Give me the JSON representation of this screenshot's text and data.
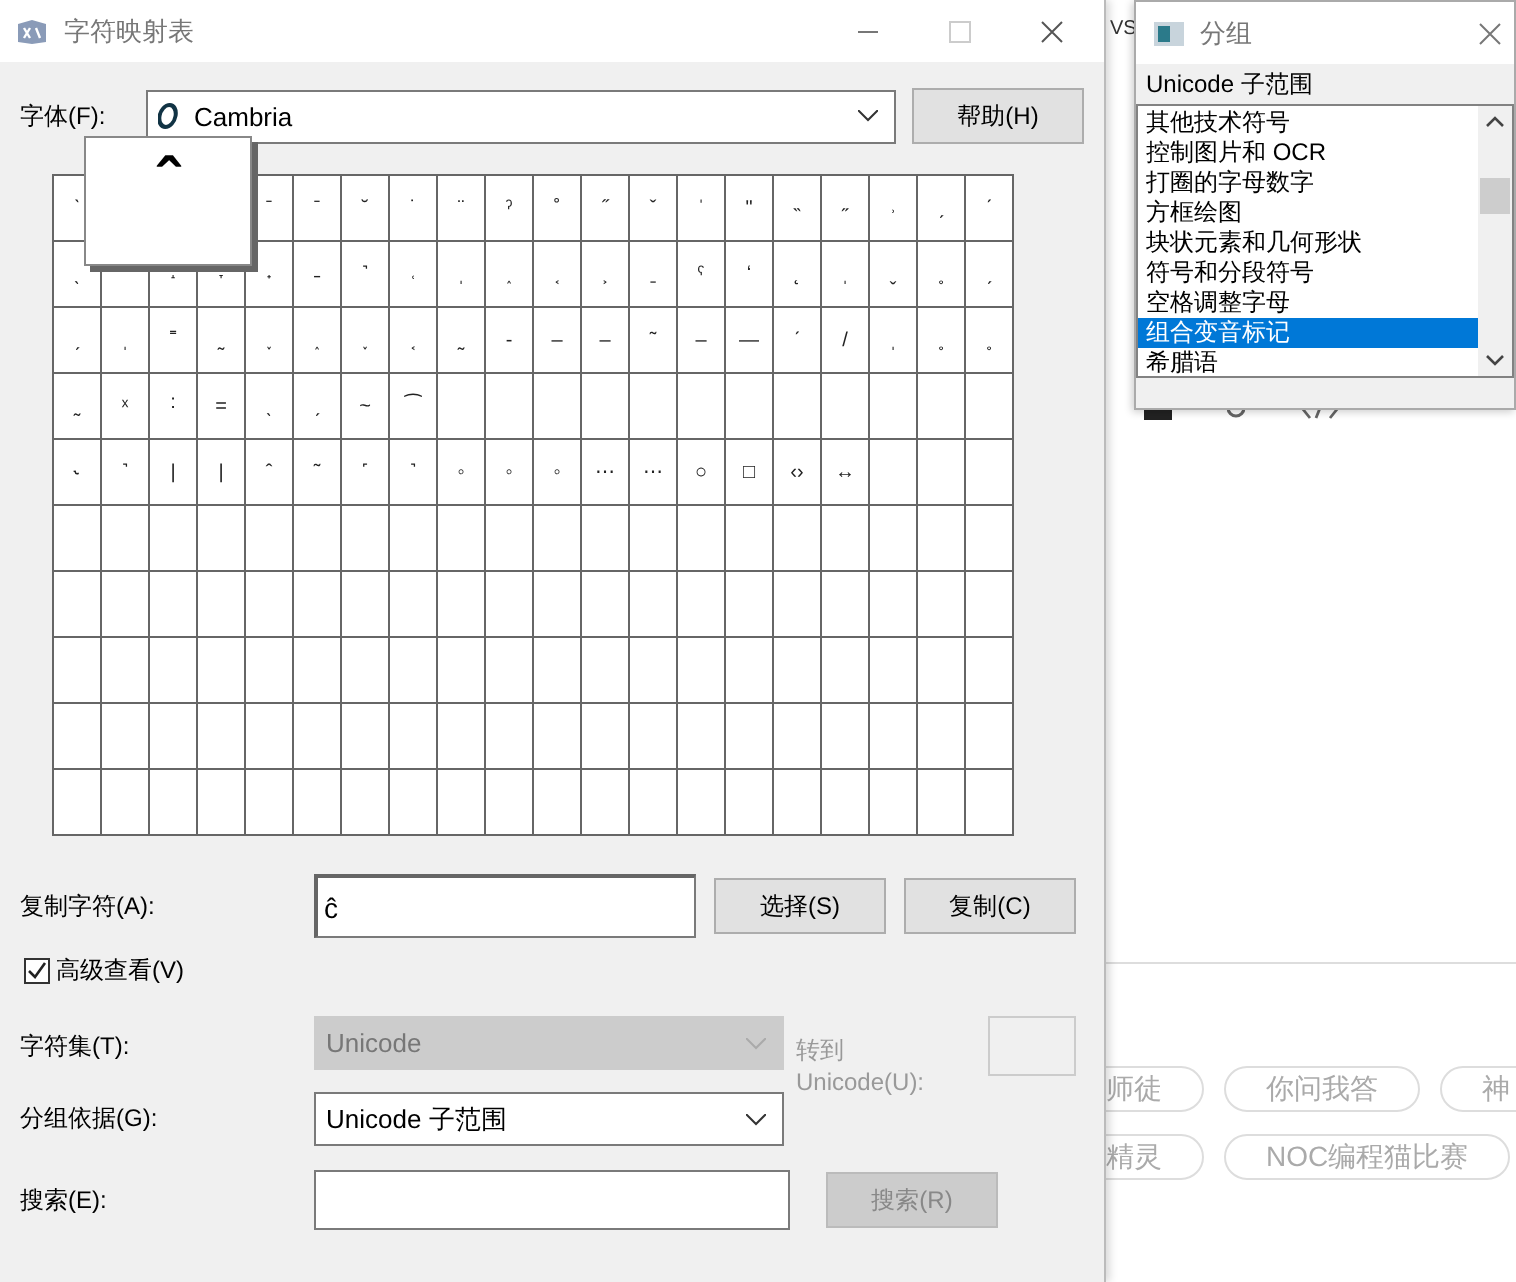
{
  "main_window": {
    "title": "字符映射表",
    "font": {
      "label": "字体(F):",
      "value": "Cambria"
    },
    "help_button": "帮助(H)",
    "grid": {
      "rows": [
        [
          "ˋ",
          null,
          null,
          null,
          "ˉ",
          "ˉ",
          "˘",
          "˙",
          "¨",
          "ˀ",
          "˚",
          "˝",
          "ˇ",
          "ˈ",
          "\"",
          "˵",
          "˶",
          "˒",
          "ˏ",
          "ˊ"
        ],
        [
          "ˎ",
          null,
          "˔",
          "˕",
          "˖",
          "˗",
          "˺",
          "˓",
          "ˌ",
          "˰",
          "˱",
          "˲",
          "ˍ",
          "ˁ",
          "ʻ",
          "˛",
          "ˌ",
          "ˬ",
          "˳",
          "ˏ"
        ],
        [
          "ˏ",
          "ˌ",
          "˭",
          "˷",
          "˯",
          "˰",
          "˯",
          "˱",
          "˷",
          "-",
          "–",
          "–",
          "˜",
          "–",
          "—",
          "ˊ",
          "/",
          "ˌ",
          "˳",
          "˳"
        ],
        [
          "˷",
          "ˣ",
          "˸",
          "=",
          "ˎ",
          "ˏ",
          "~",
          "⁀",
          null,
          null,
          null,
          null,
          null,
          null,
          null,
          null,
          null,
          null,
          null,
          null
        ],
        [
          "˞",
          "˺",
          "|",
          "|",
          "ˆ",
          "˜",
          "˹",
          "˺",
          "◦",
          "◦",
          "◦",
          "⋯",
          "⋯",
          "○",
          "□",
          "‹›",
          "↔",
          null,
          null,
          null
        ]
      ]
    },
    "magnified_char": "ˆ",
    "copy": {
      "label": "复制字符(A):",
      "value": "ĉ"
    },
    "select_button": "选择(S)",
    "copy_button": "复制(C)",
    "advanced_view": {
      "label": "高级查看(V)",
      "checked": true
    },
    "charset": {
      "label": "字符集(T):",
      "value": "Unicode",
      "disabled": true
    },
    "goto_unicode": {
      "label": "转到 Unicode(U):",
      "disabled": true
    },
    "group_by": {
      "label": "分组依据(G):",
      "value": "Unicode 子范围",
      "disabled": false
    },
    "search": {
      "label": "搜索(E):",
      "button": "搜索(R)",
      "button_disabled": true
    }
  },
  "group_dialog": {
    "title": "分组",
    "label": "Unicode 子范围",
    "items": [
      {
        "label": "其他技术符号",
        "selected": false
      },
      {
        "label": "控制图片和 OCR",
        "selected": false
      },
      {
        "label": "打圈的字母数字",
        "selected": false
      },
      {
        "label": "方框绘图",
        "selected": false
      },
      {
        "label": "块状元素和几何形状",
        "selected": false
      },
      {
        "label": "符号和分段符号",
        "selected": false
      },
      {
        "label": "空格调整字母",
        "selected": false
      },
      {
        "label": "组合变音标记",
        "selected": true
      },
      {
        "label": "希腊语",
        "selected": false
      }
    ]
  },
  "background_page": {
    "heading": "VS",
    "tags": [
      [
        "师徒",
        "你问我答",
        "神"
      ],
      [
        "精灵",
        "NOC编程猫比赛"
      ]
    ]
  }
}
